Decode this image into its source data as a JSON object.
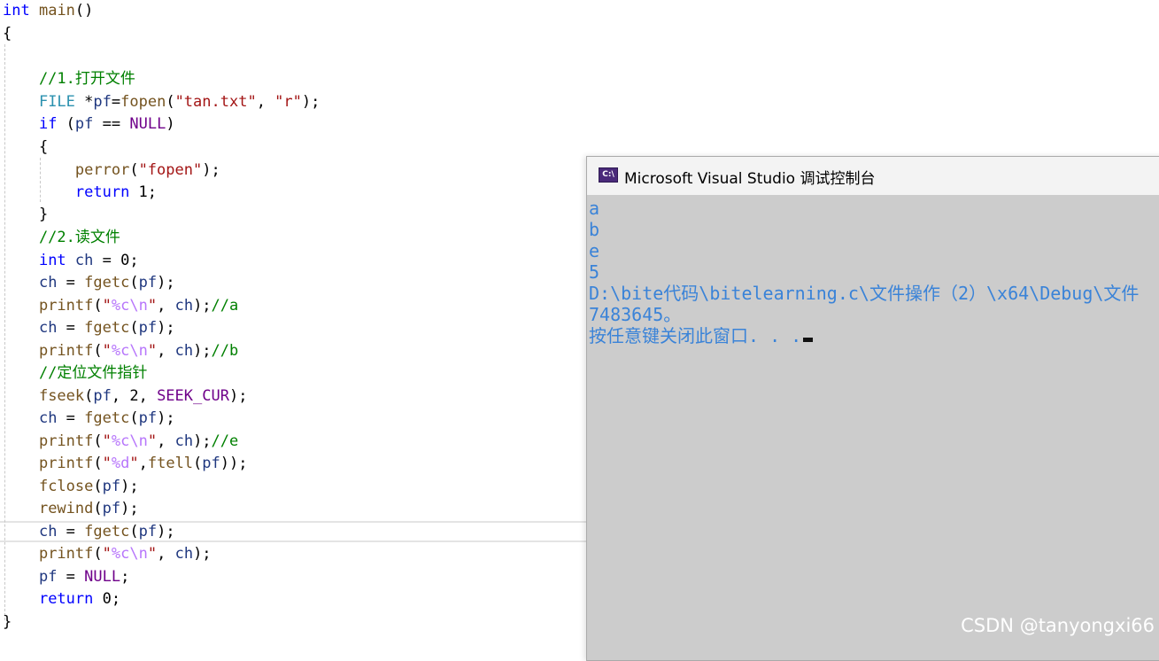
{
  "editor": {
    "lines": [
      [
        {
          "t": "int",
          "c": "kw"
        },
        {
          "t": " ",
          "c": "pl"
        },
        {
          "t": "main",
          "c": "fn"
        },
        {
          "t": "()",
          "c": "pl"
        }
      ],
      [
        {
          "t": "{",
          "c": "pl"
        }
      ],
      [],
      [
        {
          "t": "    //1.打开文件",
          "c": "cm"
        }
      ],
      [
        {
          "t": "    ",
          "c": "pl"
        },
        {
          "t": "FILE",
          "c": "ty"
        },
        {
          "t": " *",
          "c": "pl"
        },
        {
          "t": "pf",
          "c": "vr"
        },
        {
          "t": "=",
          "c": "pl"
        },
        {
          "t": "fopen",
          "c": "fn"
        },
        {
          "t": "(",
          "c": "pl"
        },
        {
          "t": "\"tan.txt\"",
          "c": "st"
        },
        {
          "t": ", ",
          "c": "pl"
        },
        {
          "t": "\"r\"",
          "c": "st"
        },
        {
          "t": ");",
          "c": "pl"
        }
      ],
      [
        {
          "t": "    ",
          "c": "pl"
        },
        {
          "t": "if",
          "c": "kw"
        },
        {
          "t": " (",
          "c": "pl"
        },
        {
          "t": "pf",
          "c": "vr"
        },
        {
          "t": " == ",
          "c": "pl"
        },
        {
          "t": "NULL",
          "c": "mc"
        },
        {
          "t": ")",
          "c": "pl"
        }
      ],
      [
        {
          "t": "    {",
          "c": "pl"
        }
      ],
      [
        {
          "t": "        ",
          "c": "pl"
        },
        {
          "t": "perror",
          "c": "fn"
        },
        {
          "t": "(",
          "c": "pl"
        },
        {
          "t": "\"fopen\"",
          "c": "st"
        },
        {
          "t": ");",
          "c": "pl"
        }
      ],
      [
        {
          "t": "        ",
          "c": "pl"
        },
        {
          "t": "return",
          "c": "kw"
        },
        {
          "t": " 1;",
          "c": "pl"
        }
      ],
      [
        {
          "t": "    }",
          "c": "pl"
        }
      ],
      [
        {
          "t": "    //2.读文件",
          "c": "cm"
        }
      ],
      [
        {
          "t": "    ",
          "c": "pl"
        },
        {
          "t": "int",
          "c": "kw"
        },
        {
          "t": " ",
          "c": "pl"
        },
        {
          "t": "ch",
          "c": "vr"
        },
        {
          "t": " = 0;",
          "c": "pl"
        }
      ],
      [
        {
          "t": "    ",
          "c": "pl"
        },
        {
          "t": "ch",
          "c": "vr"
        },
        {
          "t": " = ",
          "c": "pl"
        },
        {
          "t": "fgetc",
          "c": "fn"
        },
        {
          "t": "(",
          "c": "pl"
        },
        {
          "t": "pf",
          "c": "vr"
        },
        {
          "t": ");",
          "c": "pl"
        }
      ],
      [
        {
          "t": "    ",
          "c": "pl"
        },
        {
          "t": "printf",
          "c": "fn"
        },
        {
          "t": "(",
          "c": "pl"
        },
        {
          "t": "\"",
          "c": "st"
        },
        {
          "t": "%c",
          "c": "es"
        },
        {
          "t": "\\n",
          "c": "es"
        },
        {
          "t": "\"",
          "c": "st"
        },
        {
          "t": ", ",
          "c": "pl"
        },
        {
          "t": "ch",
          "c": "vr"
        },
        {
          "t": ");",
          "c": "pl"
        },
        {
          "t": "//a",
          "c": "cm"
        }
      ],
      [
        {
          "t": "    ",
          "c": "pl"
        },
        {
          "t": "ch",
          "c": "vr"
        },
        {
          "t": " = ",
          "c": "pl"
        },
        {
          "t": "fgetc",
          "c": "fn"
        },
        {
          "t": "(",
          "c": "pl"
        },
        {
          "t": "pf",
          "c": "vr"
        },
        {
          "t": ");",
          "c": "pl"
        }
      ],
      [
        {
          "t": "    ",
          "c": "pl"
        },
        {
          "t": "printf",
          "c": "fn"
        },
        {
          "t": "(",
          "c": "pl"
        },
        {
          "t": "\"",
          "c": "st"
        },
        {
          "t": "%c",
          "c": "es"
        },
        {
          "t": "\\n",
          "c": "es"
        },
        {
          "t": "\"",
          "c": "st"
        },
        {
          "t": ", ",
          "c": "pl"
        },
        {
          "t": "ch",
          "c": "vr"
        },
        {
          "t": ");",
          "c": "pl"
        },
        {
          "t": "//b",
          "c": "cm"
        }
      ],
      [
        {
          "t": "    //定位文件指针",
          "c": "cm"
        }
      ],
      [
        {
          "t": "    ",
          "c": "pl"
        },
        {
          "t": "fseek",
          "c": "fn"
        },
        {
          "t": "(",
          "c": "pl"
        },
        {
          "t": "pf",
          "c": "vr"
        },
        {
          "t": ", 2, ",
          "c": "pl"
        },
        {
          "t": "SEEK_CUR",
          "c": "mc"
        },
        {
          "t": ");",
          "c": "pl"
        }
      ],
      [
        {
          "t": "    ",
          "c": "pl"
        },
        {
          "t": "ch",
          "c": "vr"
        },
        {
          "t": " = ",
          "c": "pl"
        },
        {
          "t": "fgetc",
          "c": "fn"
        },
        {
          "t": "(",
          "c": "pl"
        },
        {
          "t": "pf",
          "c": "vr"
        },
        {
          "t": ");",
          "c": "pl"
        }
      ],
      [
        {
          "t": "    ",
          "c": "pl"
        },
        {
          "t": "printf",
          "c": "fn"
        },
        {
          "t": "(",
          "c": "pl"
        },
        {
          "t": "\"",
          "c": "st"
        },
        {
          "t": "%c",
          "c": "es"
        },
        {
          "t": "\\n",
          "c": "es"
        },
        {
          "t": "\"",
          "c": "st"
        },
        {
          "t": ", ",
          "c": "pl"
        },
        {
          "t": "ch",
          "c": "vr"
        },
        {
          "t": ");",
          "c": "pl"
        },
        {
          "t": "//e",
          "c": "cm"
        }
      ],
      [
        {
          "t": "    ",
          "c": "pl"
        },
        {
          "t": "printf",
          "c": "fn"
        },
        {
          "t": "(",
          "c": "pl"
        },
        {
          "t": "\"",
          "c": "st"
        },
        {
          "t": "%d",
          "c": "es"
        },
        {
          "t": "\"",
          "c": "st"
        },
        {
          "t": ",",
          "c": "pl"
        },
        {
          "t": "ftell",
          "c": "fn"
        },
        {
          "t": "(",
          "c": "pl"
        },
        {
          "t": "pf",
          "c": "vr"
        },
        {
          "t": "));",
          "c": "pl"
        }
      ],
      [
        {
          "t": "    ",
          "c": "pl"
        },
        {
          "t": "fclose",
          "c": "fn"
        },
        {
          "t": "(",
          "c": "pl"
        },
        {
          "t": "pf",
          "c": "vr"
        },
        {
          "t": ");",
          "c": "pl"
        }
      ],
      [
        {
          "t": "    ",
          "c": "pl"
        },
        {
          "t": "rewind",
          "c": "fn"
        },
        {
          "t": "(",
          "c": "pl"
        },
        {
          "t": "pf",
          "c": "vr"
        },
        {
          "t": ");",
          "c": "pl"
        }
      ],
      [
        {
          "t": "    ",
          "c": "pl"
        },
        {
          "t": "ch",
          "c": "vr"
        },
        {
          "t": " = ",
          "c": "pl"
        },
        {
          "t": "fgetc",
          "c": "fn"
        },
        {
          "t": "(",
          "c": "pl"
        },
        {
          "t": "pf",
          "c": "vr"
        },
        {
          "t": ");",
          "c": "pl"
        }
      ],
      [
        {
          "t": "    ",
          "c": "pl"
        },
        {
          "t": "printf",
          "c": "fn"
        },
        {
          "t": "(",
          "c": "pl"
        },
        {
          "t": "\"",
          "c": "st"
        },
        {
          "t": "%c",
          "c": "es"
        },
        {
          "t": "\\n",
          "c": "es"
        },
        {
          "t": "\"",
          "c": "st"
        },
        {
          "t": ", ",
          "c": "pl"
        },
        {
          "t": "ch",
          "c": "vr"
        },
        {
          "t": ");",
          "c": "pl"
        }
      ],
      [
        {
          "t": "    ",
          "c": "pl"
        },
        {
          "t": "pf",
          "c": "vr"
        },
        {
          "t": " = ",
          "c": "pl"
        },
        {
          "t": "NULL",
          "c": "mc"
        },
        {
          "t": ";",
          "c": "pl"
        }
      ],
      [
        {
          "t": "    ",
          "c": "pl"
        },
        {
          "t": "return",
          "c": "kw"
        },
        {
          "t": " 0;",
          "c": "pl"
        }
      ],
      [
        {
          "t": "}",
          "c": "pl"
        }
      ]
    ]
  },
  "console": {
    "icon_label": "C:\\",
    "title": "Microsoft Visual Studio 调试控制台",
    "output": [
      "a",
      "b",
      "e",
      "5",
      "D:\\bite代码\\bitelearning.c\\文件操作（2）\\x64\\Debug\\文件",
      "7483645。",
      "按任意键关闭此窗口. . ."
    ]
  },
  "watermark": "CSDN @tanyongxi66",
  "colors": {
    "keyword": "#0000ff",
    "type": "#2b91af",
    "function": "#74531f",
    "string": "#a31515",
    "escape": "#b776fb",
    "comment": "#008000",
    "macro": "#6f008a",
    "variable": "#1f377f",
    "console_text": "#3a83d8",
    "console_bg": "#cccccc"
  }
}
